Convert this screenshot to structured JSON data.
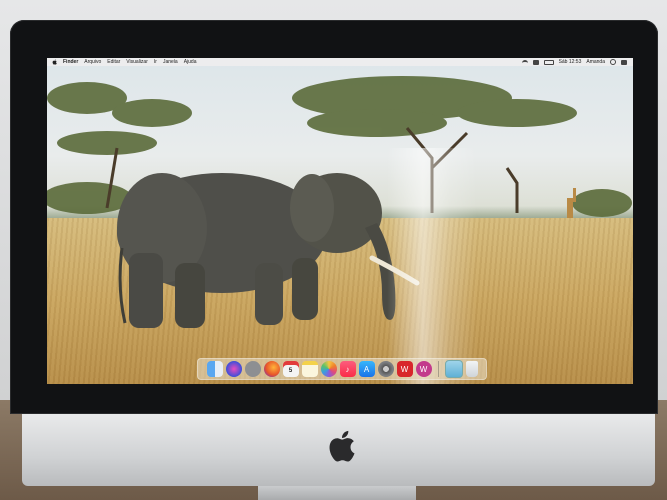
{
  "menubar": {
    "finder": "Finder",
    "menus": [
      "Arquivo",
      "Editar",
      "Visualizar",
      "Ir",
      "Janela",
      "Ajuda"
    ],
    "clock": "Sáb 12:53",
    "user": "Amanda"
  },
  "dock": {
    "apps": [
      {
        "icon": "finder-icon",
        "color": "#3b8de0"
      },
      {
        "icon": "siri-icon",
        "color": "#6a4fd6"
      },
      {
        "icon": "launchpad-icon",
        "color": "#8d8f92"
      },
      {
        "icon": "firefox-icon",
        "color": "#e8562a"
      },
      {
        "icon": "calendar-icon",
        "color": "#f4f4f4",
        "label": "5"
      },
      {
        "icon": "notes-icon",
        "color": "#f4e39a"
      },
      {
        "icon": "photos-icon",
        "color": "#f2f2f2"
      },
      {
        "icon": "music-icon",
        "color": "#fa3e5e"
      },
      {
        "icon": "app-store-icon",
        "color": "#2f8af5"
      },
      {
        "icon": "system-preferences-icon",
        "color": "#7b7d80"
      },
      {
        "icon": "wps-office-icon",
        "color": "#d8262b",
        "label": "W"
      },
      {
        "icon": "wps-writer-icon",
        "color": "#c33a8c",
        "label": "W"
      }
    ],
    "trailing": [
      {
        "icon": "downloads-folder-icon",
        "color": "#6fb9d8"
      },
      {
        "icon": "trash-icon",
        "color": "#dfe3e6"
      }
    ]
  }
}
